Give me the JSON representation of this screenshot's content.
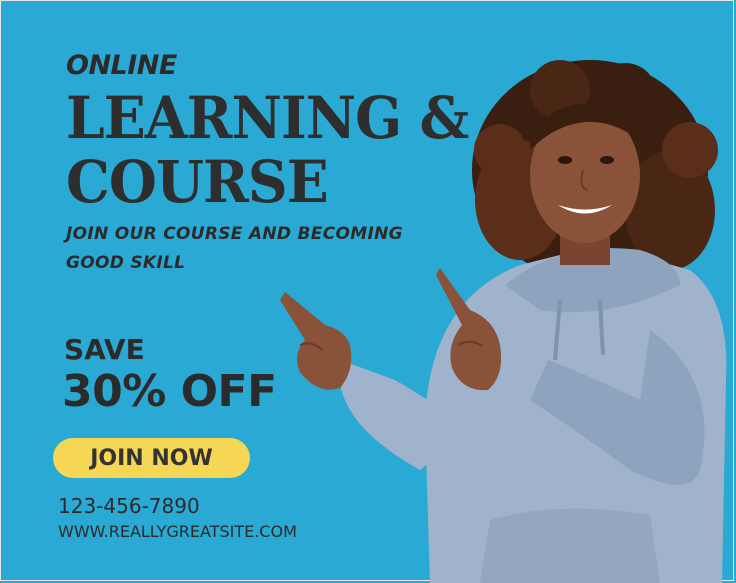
{
  "ad": {
    "eyebrow": "ONLINE",
    "headline_line1": "LEARNING &",
    "headline_line2": "COURSE",
    "subhead_line1": "JOIN OUR COURSE AND BECOMING",
    "subhead_line2": "GOOD SKILL",
    "save_label": "SAVE",
    "discount": "30% OFF",
    "cta_label": "JOIN NOW",
    "phone": "123-456-7890",
    "website": "WWW.REALLYGREATSITE.COM"
  },
  "colors": {
    "background": "#29a9d3",
    "text": "#2b2b2b",
    "button": "#f5d655",
    "hoodie": "#9fb3cc",
    "skin": "#8a5238",
    "hair": "#3a1e10"
  },
  "image": {
    "subject": "person-in-hoodie-pointing-icon"
  }
}
